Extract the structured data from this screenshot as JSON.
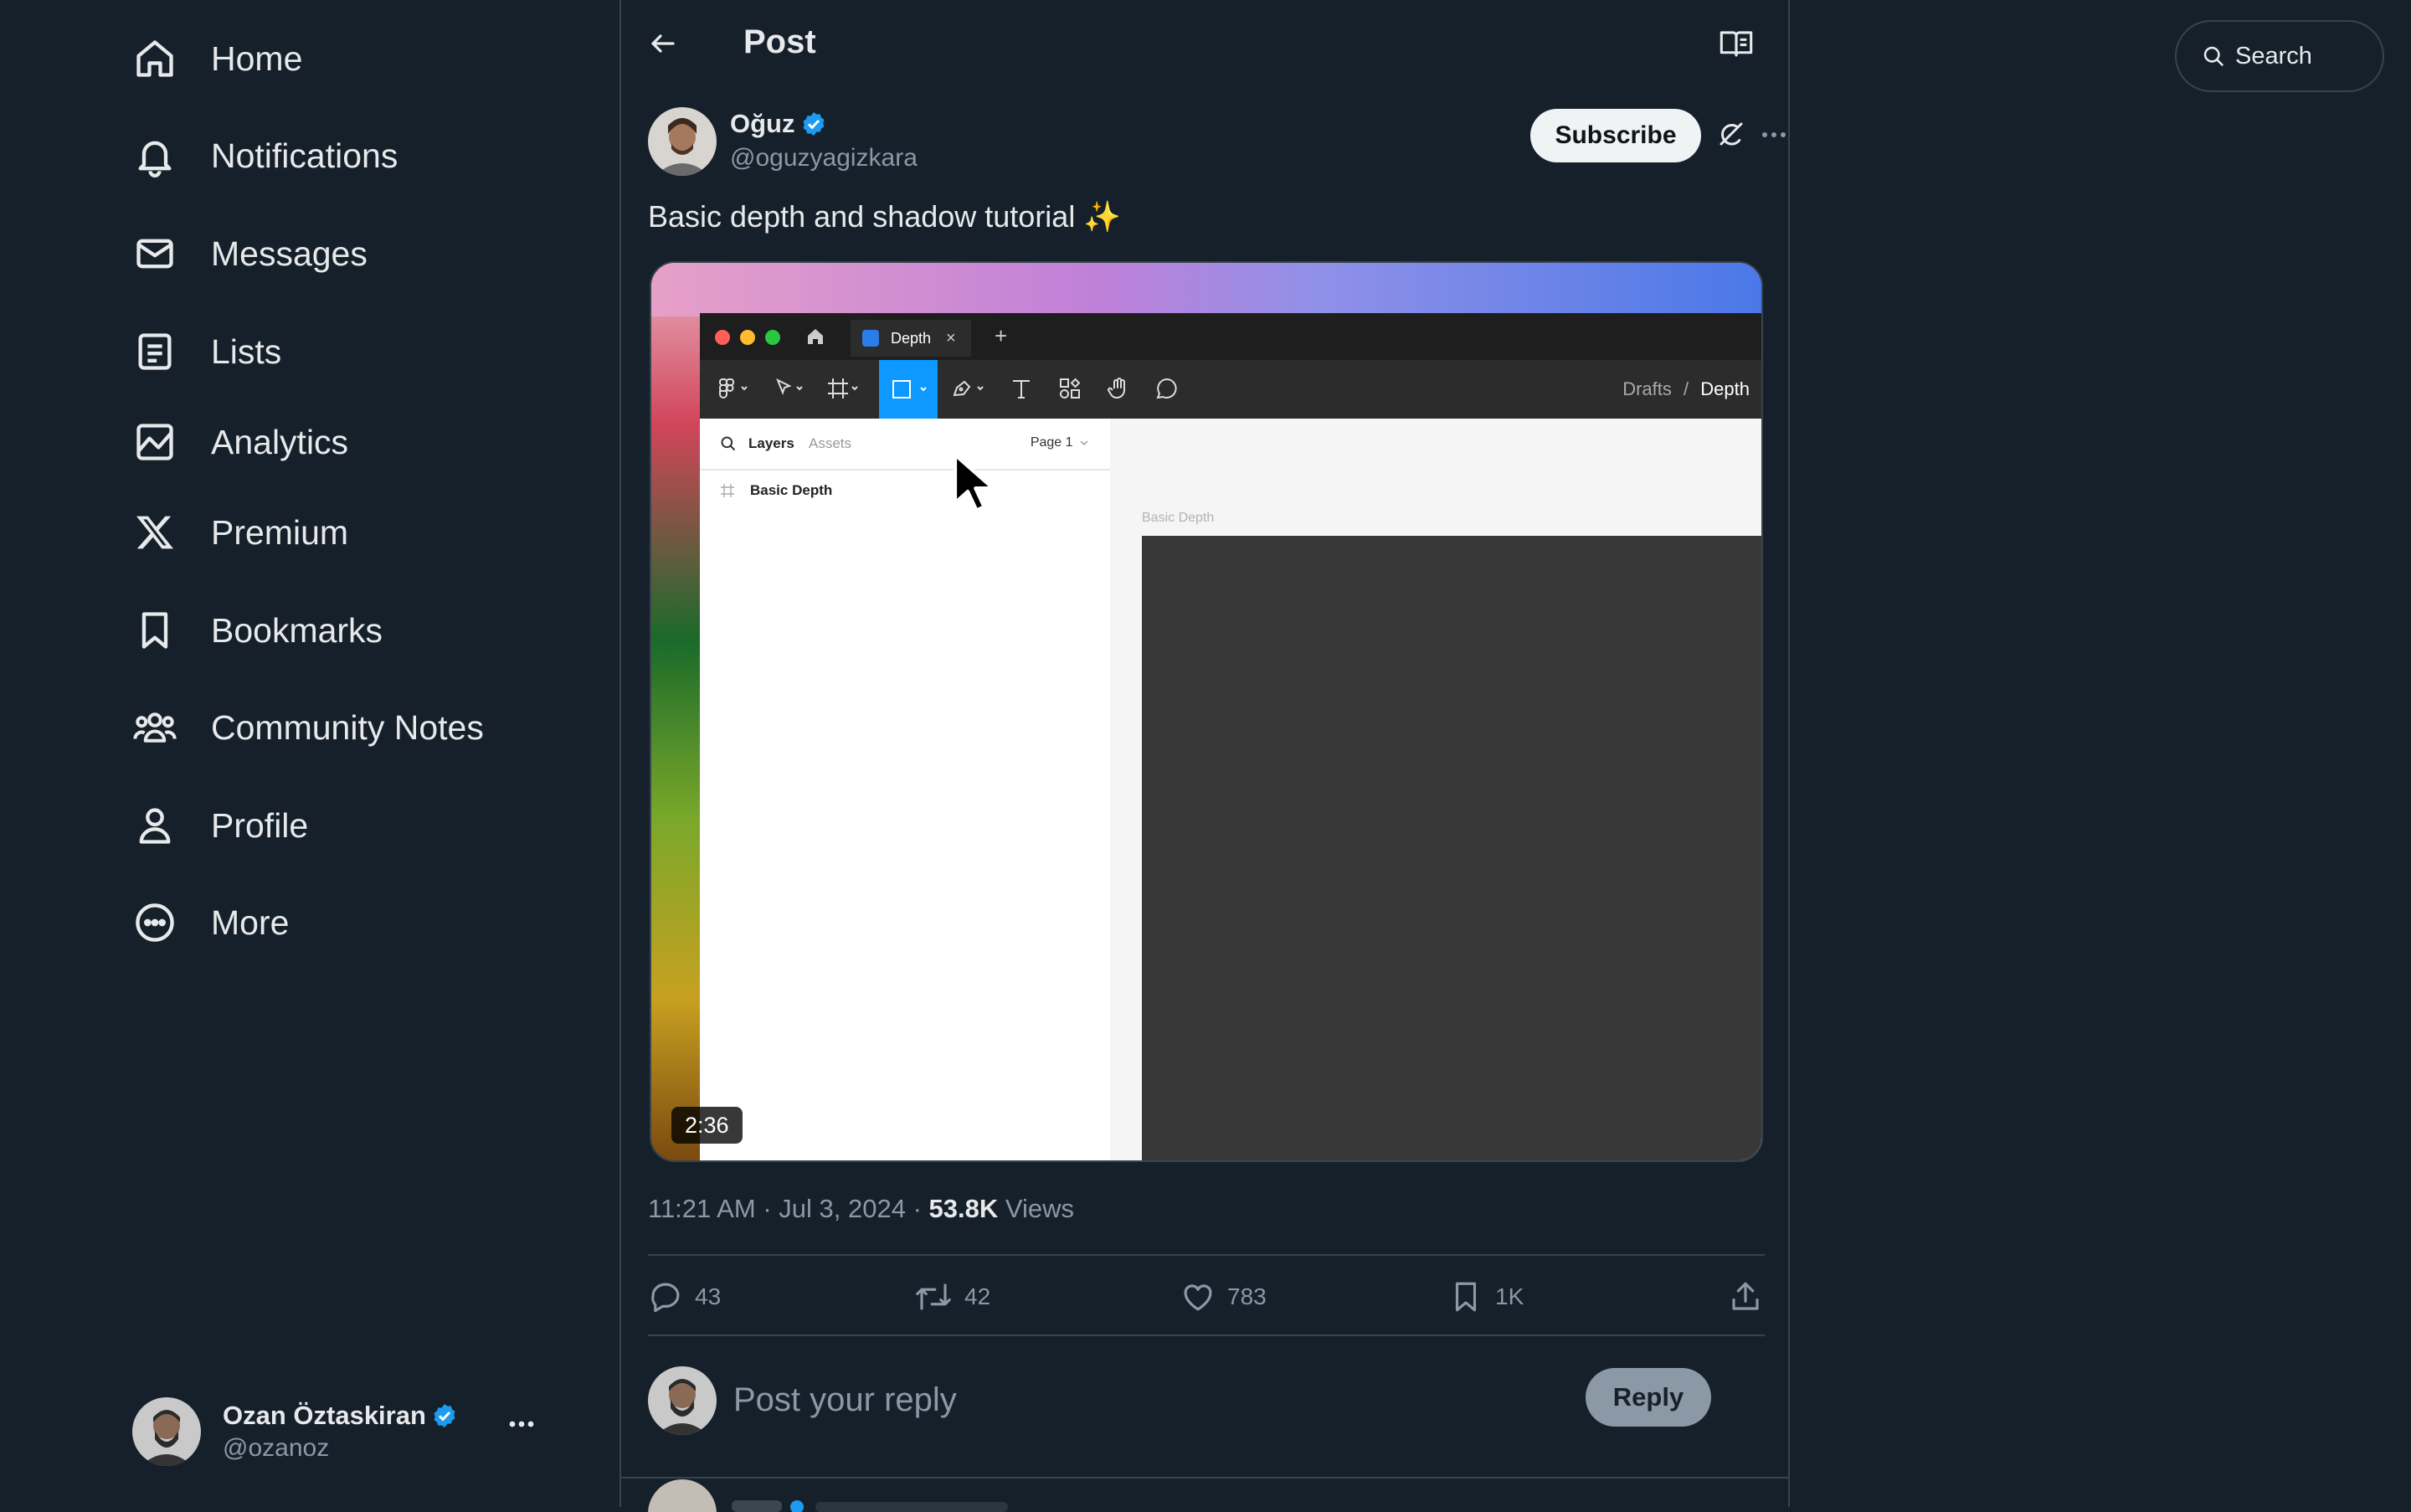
{
  "sidebar": {
    "nav": [
      {
        "label": "Home",
        "icon": "home-icon"
      },
      {
        "label": "Notifications",
        "icon": "bell-icon"
      },
      {
        "label": "Messages",
        "icon": "envelope-icon"
      },
      {
        "label": "Lists",
        "icon": "list-icon"
      },
      {
        "label": "Analytics",
        "icon": "analytics-icon"
      },
      {
        "label": "Premium",
        "icon": "x-logo-icon"
      },
      {
        "label": "Bookmarks",
        "icon": "bookmark-icon"
      },
      {
        "label": "Community Notes",
        "icon": "community-icon"
      },
      {
        "label": "Profile",
        "icon": "person-icon"
      },
      {
        "label": "More",
        "icon": "more-circle-icon"
      }
    ],
    "account": {
      "name": "Ozan Öztaskiran",
      "handle": "@ozanoz",
      "verified": true
    }
  },
  "header": {
    "title": "Post"
  },
  "post": {
    "author": {
      "name": "Oğuz",
      "handle": "@oguzyagizkara",
      "verified": true
    },
    "subscribe_label": "Subscribe",
    "text": "Basic depth and shadow tutorial ✨",
    "media": {
      "duration": "2:36",
      "app": {
        "tab_label": "Depth",
        "tab_close": "×",
        "tab_add": "+",
        "breadcrumb_parent": "Drafts",
        "breadcrumb_separator": "/",
        "breadcrumb_current": "Depth",
        "panel_tab_layers": "Layers",
        "panel_tab_assets": "Assets",
        "page_select": "Page 1",
        "layer_name": "Basic Depth",
        "frame_label": "Basic Depth",
        "active_tool": "rectangle-tool"
      }
    },
    "meta": {
      "time": "11:21 AM",
      "separator": "·",
      "date": "Jul 3, 2024",
      "views_count": "53.8K",
      "views_label": "Views"
    },
    "actions": {
      "replies": "43",
      "reposts": "42",
      "likes": "783",
      "bookmarks": "1K"
    }
  },
  "reply": {
    "placeholder": "Post your reply",
    "button_label": "Reply"
  },
  "search": {
    "placeholder": "Search"
  },
  "colors": {
    "background": "#15202b",
    "border": "#38444d",
    "text_primary": "#e7e9ea",
    "text_secondary": "#8b98a5",
    "verified_blue": "#1d9bf0",
    "figma_active_blue": "#0d99ff"
  }
}
